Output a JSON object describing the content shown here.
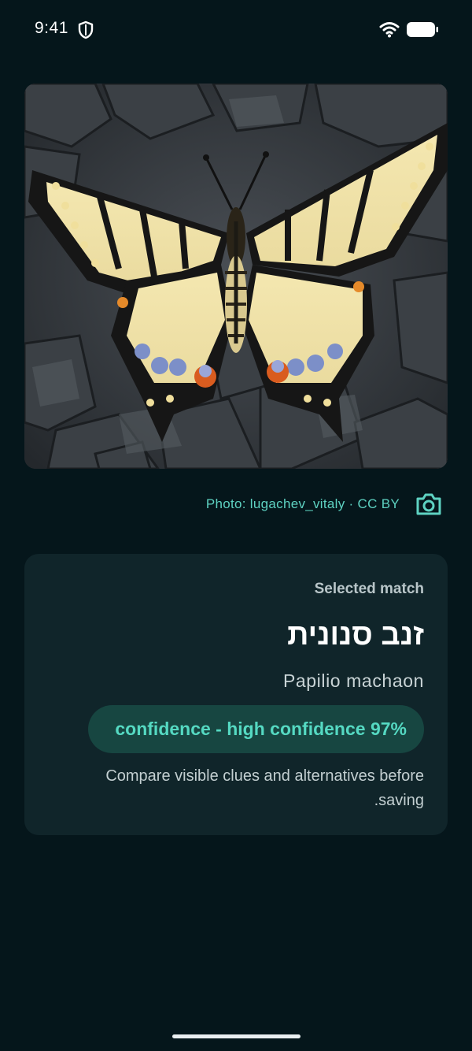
{
  "status_bar": {
    "time": "9:41",
    "icons": [
      "shield-icon",
      "wifi-icon",
      "battery-icon"
    ]
  },
  "photo": {
    "subject": "butterfly-photo",
    "credit": "Photo: lugachev_vitaly · CC BY",
    "credit_icon": "camera-icon"
  },
  "result_card": {
    "label": "Selected match",
    "common_name": "זנב סנונית",
    "scientific_name": "Papilio machaon",
    "confidence_text": "confidence - high confidence 97%",
    "confidence_value": 0.97,
    "note_line1": "Compare visible clues and alternatives before",
    "note_line2": ".saving"
  },
  "colors": {
    "background": "#05161b",
    "card": "#10252a",
    "accent": "#55d9c2",
    "pill": "#174641"
  }
}
